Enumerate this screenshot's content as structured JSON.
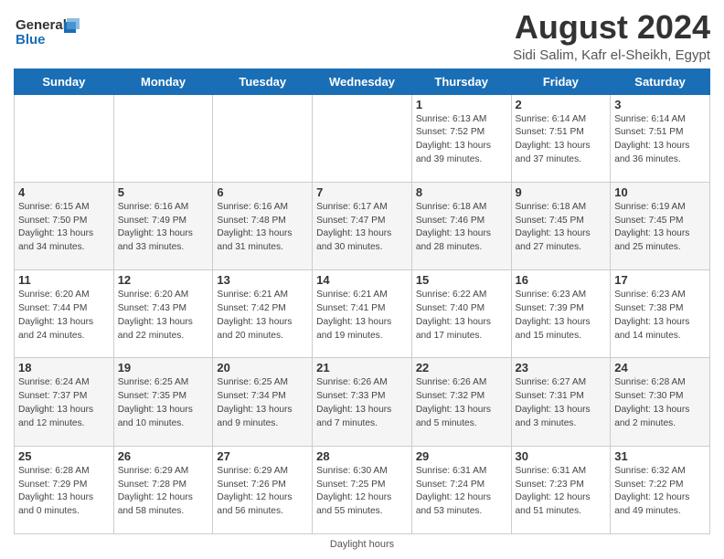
{
  "header": {
    "logo_line1": "General",
    "logo_line2": "Blue",
    "main_title": "August 2024",
    "subtitle": "Sidi Salim, Kafr el-Sheikh, Egypt"
  },
  "days_of_week": [
    "Sunday",
    "Monday",
    "Tuesday",
    "Wednesday",
    "Thursday",
    "Friday",
    "Saturday"
  ],
  "weeks": [
    [
      {
        "day": "",
        "info": ""
      },
      {
        "day": "",
        "info": ""
      },
      {
        "day": "",
        "info": ""
      },
      {
        "day": "",
        "info": ""
      },
      {
        "day": "1",
        "info": "Sunrise: 6:13 AM\nSunset: 7:52 PM\nDaylight: 13 hours and 39 minutes."
      },
      {
        "day": "2",
        "info": "Sunrise: 6:14 AM\nSunset: 7:51 PM\nDaylight: 13 hours and 37 minutes."
      },
      {
        "day": "3",
        "info": "Sunrise: 6:14 AM\nSunset: 7:51 PM\nDaylight: 13 hours and 36 minutes."
      }
    ],
    [
      {
        "day": "4",
        "info": "Sunrise: 6:15 AM\nSunset: 7:50 PM\nDaylight: 13 hours and 34 minutes."
      },
      {
        "day": "5",
        "info": "Sunrise: 6:16 AM\nSunset: 7:49 PM\nDaylight: 13 hours and 33 minutes."
      },
      {
        "day": "6",
        "info": "Sunrise: 6:16 AM\nSunset: 7:48 PM\nDaylight: 13 hours and 31 minutes."
      },
      {
        "day": "7",
        "info": "Sunrise: 6:17 AM\nSunset: 7:47 PM\nDaylight: 13 hours and 30 minutes."
      },
      {
        "day": "8",
        "info": "Sunrise: 6:18 AM\nSunset: 7:46 PM\nDaylight: 13 hours and 28 minutes."
      },
      {
        "day": "9",
        "info": "Sunrise: 6:18 AM\nSunset: 7:45 PM\nDaylight: 13 hours and 27 minutes."
      },
      {
        "day": "10",
        "info": "Sunrise: 6:19 AM\nSunset: 7:45 PM\nDaylight: 13 hours and 25 minutes."
      }
    ],
    [
      {
        "day": "11",
        "info": "Sunrise: 6:20 AM\nSunset: 7:44 PM\nDaylight: 13 hours and 24 minutes."
      },
      {
        "day": "12",
        "info": "Sunrise: 6:20 AM\nSunset: 7:43 PM\nDaylight: 13 hours and 22 minutes."
      },
      {
        "day": "13",
        "info": "Sunrise: 6:21 AM\nSunset: 7:42 PM\nDaylight: 13 hours and 20 minutes."
      },
      {
        "day": "14",
        "info": "Sunrise: 6:21 AM\nSunset: 7:41 PM\nDaylight: 13 hours and 19 minutes."
      },
      {
        "day": "15",
        "info": "Sunrise: 6:22 AM\nSunset: 7:40 PM\nDaylight: 13 hours and 17 minutes."
      },
      {
        "day": "16",
        "info": "Sunrise: 6:23 AM\nSunset: 7:39 PM\nDaylight: 13 hours and 15 minutes."
      },
      {
        "day": "17",
        "info": "Sunrise: 6:23 AM\nSunset: 7:38 PM\nDaylight: 13 hours and 14 minutes."
      }
    ],
    [
      {
        "day": "18",
        "info": "Sunrise: 6:24 AM\nSunset: 7:37 PM\nDaylight: 13 hours and 12 minutes."
      },
      {
        "day": "19",
        "info": "Sunrise: 6:25 AM\nSunset: 7:35 PM\nDaylight: 13 hours and 10 minutes."
      },
      {
        "day": "20",
        "info": "Sunrise: 6:25 AM\nSunset: 7:34 PM\nDaylight: 13 hours and 9 minutes."
      },
      {
        "day": "21",
        "info": "Sunrise: 6:26 AM\nSunset: 7:33 PM\nDaylight: 13 hours and 7 minutes."
      },
      {
        "day": "22",
        "info": "Sunrise: 6:26 AM\nSunset: 7:32 PM\nDaylight: 13 hours and 5 minutes."
      },
      {
        "day": "23",
        "info": "Sunrise: 6:27 AM\nSunset: 7:31 PM\nDaylight: 13 hours and 3 minutes."
      },
      {
        "day": "24",
        "info": "Sunrise: 6:28 AM\nSunset: 7:30 PM\nDaylight: 13 hours and 2 minutes."
      }
    ],
    [
      {
        "day": "25",
        "info": "Sunrise: 6:28 AM\nSunset: 7:29 PM\nDaylight: 13 hours and 0 minutes."
      },
      {
        "day": "26",
        "info": "Sunrise: 6:29 AM\nSunset: 7:28 PM\nDaylight: 12 hours and 58 minutes."
      },
      {
        "day": "27",
        "info": "Sunrise: 6:29 AM\nSunset: 7:26 PM\nDaylight: 12 hours and 56 minutes."
      },
      {
        "day": "28",
        "info": "Sunrise: 6:30 AM\nSunset: 7:25 PM\nDaylight: 12 hours and 55 minutes."
      },
      {
        "day": "29",
        "info": "Sunrise: 6:31 AM\nSunset: 7:24 PM\nDaylight: 12 hours and 53 minutes."
      },
      {
        "day": "30",
        "info": "Sunrise: 6:31 AM\nSunset: 7:23 PM\nDaylight: 12 hours and 51 minutes."
      },
      {
        "day": "31",
        "info": "Sunrise: 6:32 AM\nSunset: 7:22 PM\nDaylight: 12 hours and 49 minutes."
      }
    ]
  ],
  "footer": {
    "daylight_label": "Daylight hours"
  }
}
